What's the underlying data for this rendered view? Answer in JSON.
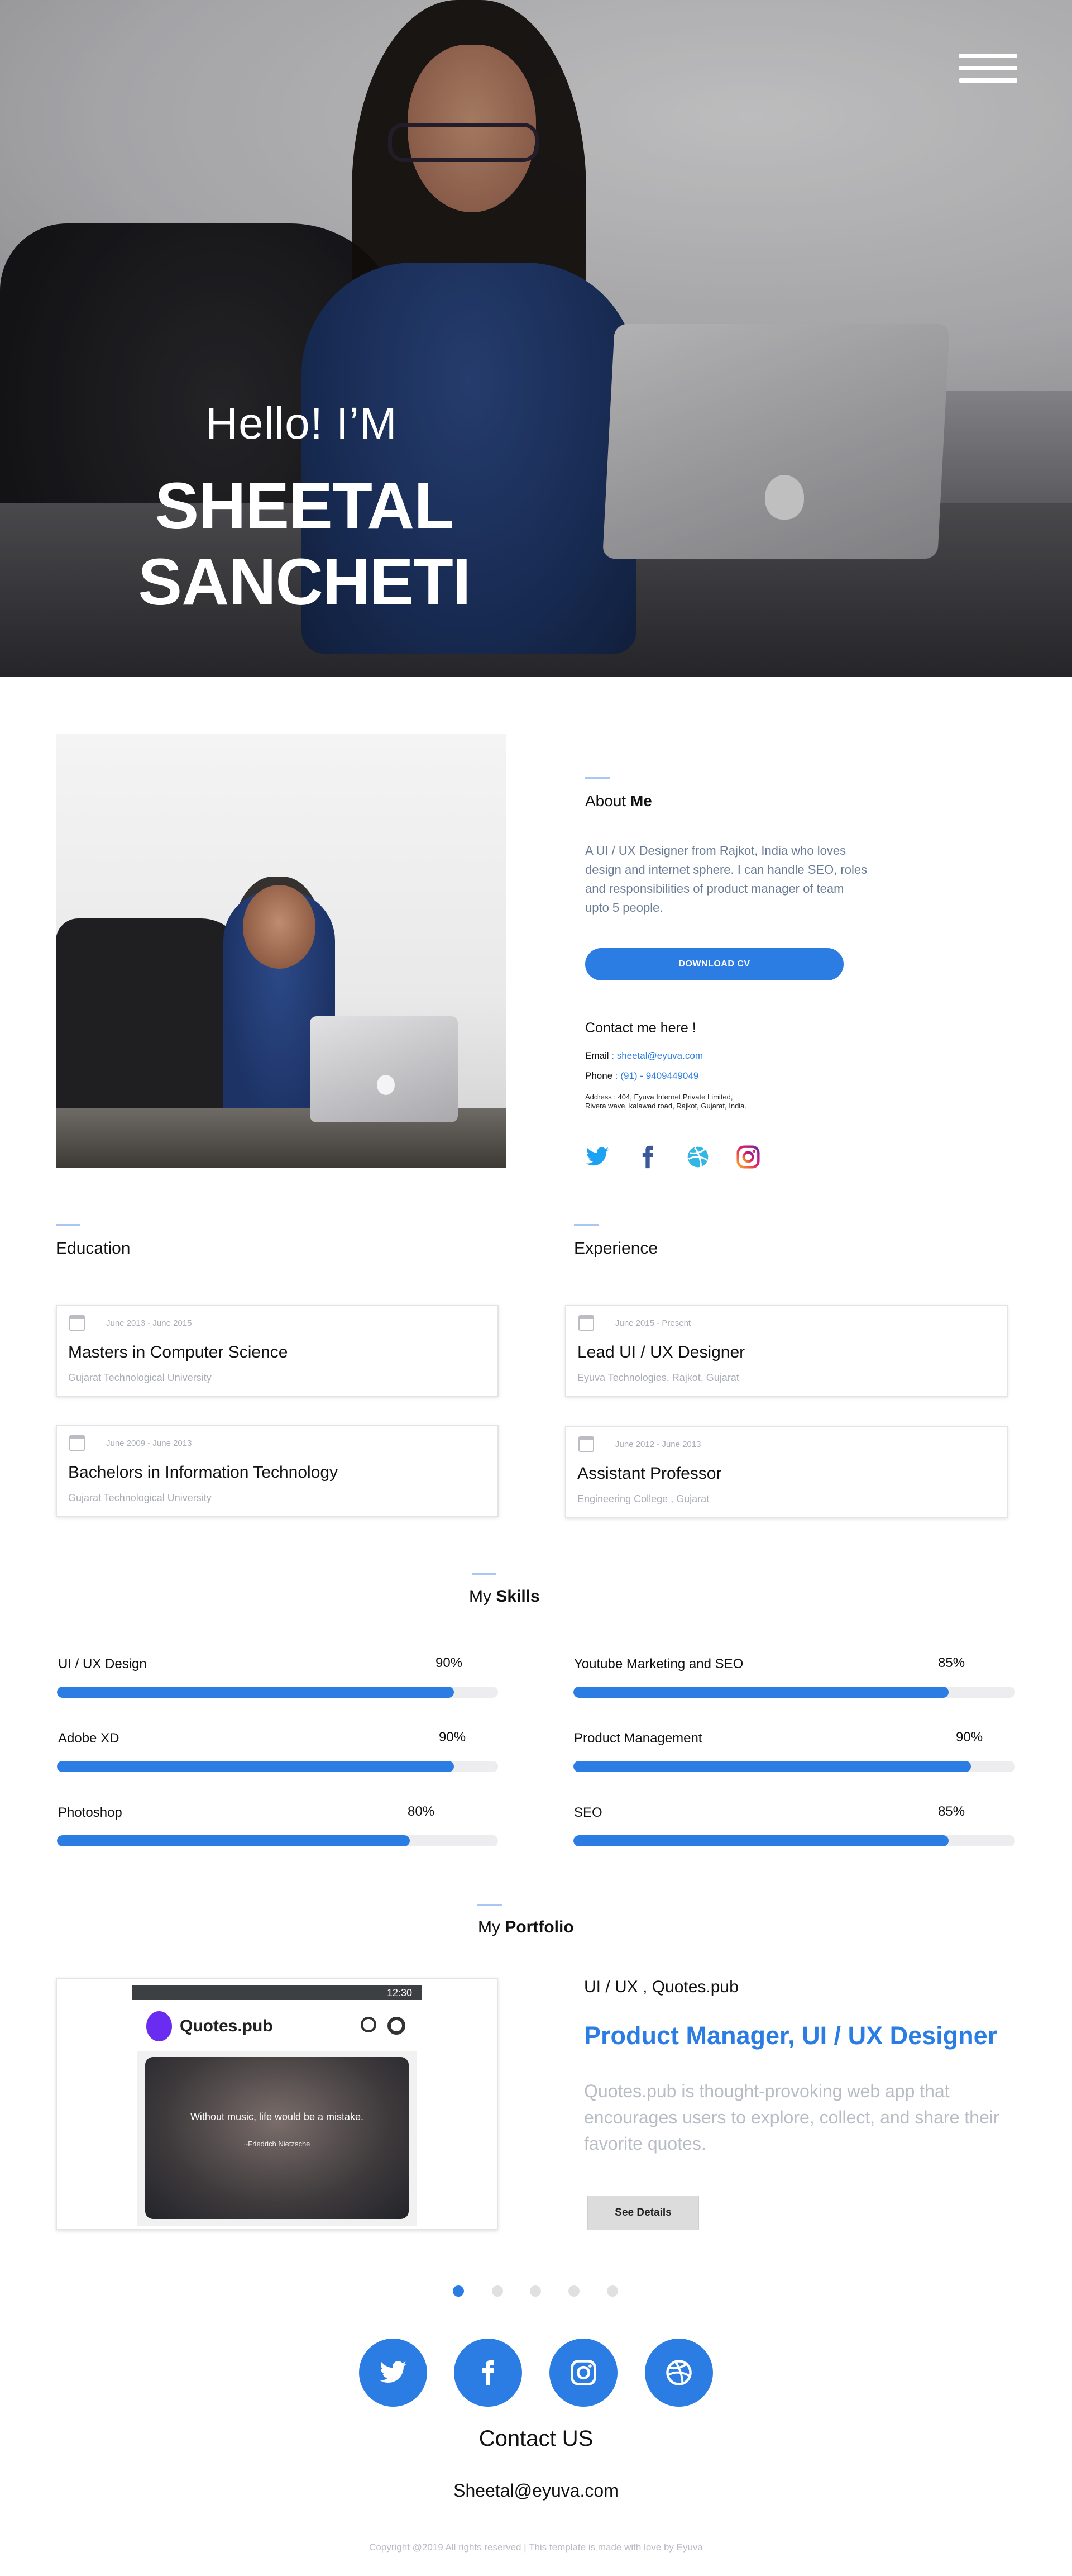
{
  "hero": {
    "greeting": "Hello! I’M",
    "name": "SHEETAL SANCHETI"
  },
  "about": {
    "title_prefix": "About ",
    "title_bold": "Me",
    "text": "A UI / UX Designer from Rajkot, India who loves design and internet sphere. I can handle SEO, roles and responsibilities of product manager of team upto 5 people.",
    "download_button": "DOWNLOAD CV",
    "contact_heading": "Contact me here !",
    "email_label": "Email",
    "email_value": ": sheetal@eyuva.com",
    "phone_label": "Phone",
    "phone_value": ": (91) - 9409449049",
    "address_label": "Address",
    "address_value": ": 404, Eyuva Internet Private Limited, Rivera wave, kalawad road, Rajkot, Gujarat, India.",
    "social": [
      "twitter-icon",
      "facebook-icon",
      "dribbble-icon",
      "instagram-icon"
    ]
  },
  "education": {
    "title": "Education",
    "items": [
      {
        "date": "June 2013 - June 2015",
        "title": "Masters in Computer Science",
        "org": "Gujarat Technological University"
      },
      {
        "date": "June 2009 - June 2013",
        "title": "Bachelors in Information Technology",
        "org": "Gujarat Technological University"
      }
    ]
  },
  "experience": {
    "title": "Experience",
    "items": [
      {
        "date": "June 2015 - Present",
        "title": "Lead UI / UX Designer",
        "org": "Eyuva Technologies, Rajkot, Gujarat"
      },
      {
        "date": "June 2012 - June 2013",
        "title": "Assistant Professor",
        "org": "Engineering College , Gujarat"
      }
    ]
  },
  "skills": {
    "title_prefix": "My ",
    "title_bold": "Skills",
    "items": [
      {
        "name": "UI / UX Design",
        "percent_label": "90%",
        "level": 0.9
      },
      {
        "name": "Youtube Marketing and SEO",
        "percent_label": "85%",
        "level": 0.85
      },
      {
        "name": "Adobe XD",
        "percent_label": "90%",
        "level": 0.9
      },
      {
        "name": "Product Management",
        "percent_label": "90%",
        "level": 0.9
      },
      {
        "name": "Photoshop",
        "percent_label": "80%",
        "level": 0.8
      },
      {
        "name": "SEO",
        "percent_label": "85%",
        "level": 0.85
      }
    ]
  },
  "portfolio": {
    "title_prefix": "My ",
    "title_bold": "Portfolio",
    "status_time": "12:30",
    "app_name": "Quotes.pub",
    "quote_text": "Without music, life would be a mistake.",
    "quote_author": "~Friedrich Nietzsche",
    "category": "UI / UX , Quotes.pub",
    "role": "Product Manager, UI / UX Designer",
    "description": "Quotes.pub is thought-provoking web app that encourages users to explore, collect, and share their favorite quotes.",
    "button": "See Details",
    "slides": 5,
    "active_slide": 0
  },
  "footer": {
    "social": [
      "twitter-icon",
      "facebook-icon",
      "instagram-icon",
      "dribbble-icon"
    ],
    "contact_heading": "Contact US",
    "email": "Sheetal@eyuva.com",
    "copyright": "Copyright @2019 All rights reserved | This template is made with love by Eyuva"
  },
  "colors": {
    "accent": "#2b7de4",
    "muted_text": "#6a7c95",
    "light_text": "#b8bcc4"
  }
}
